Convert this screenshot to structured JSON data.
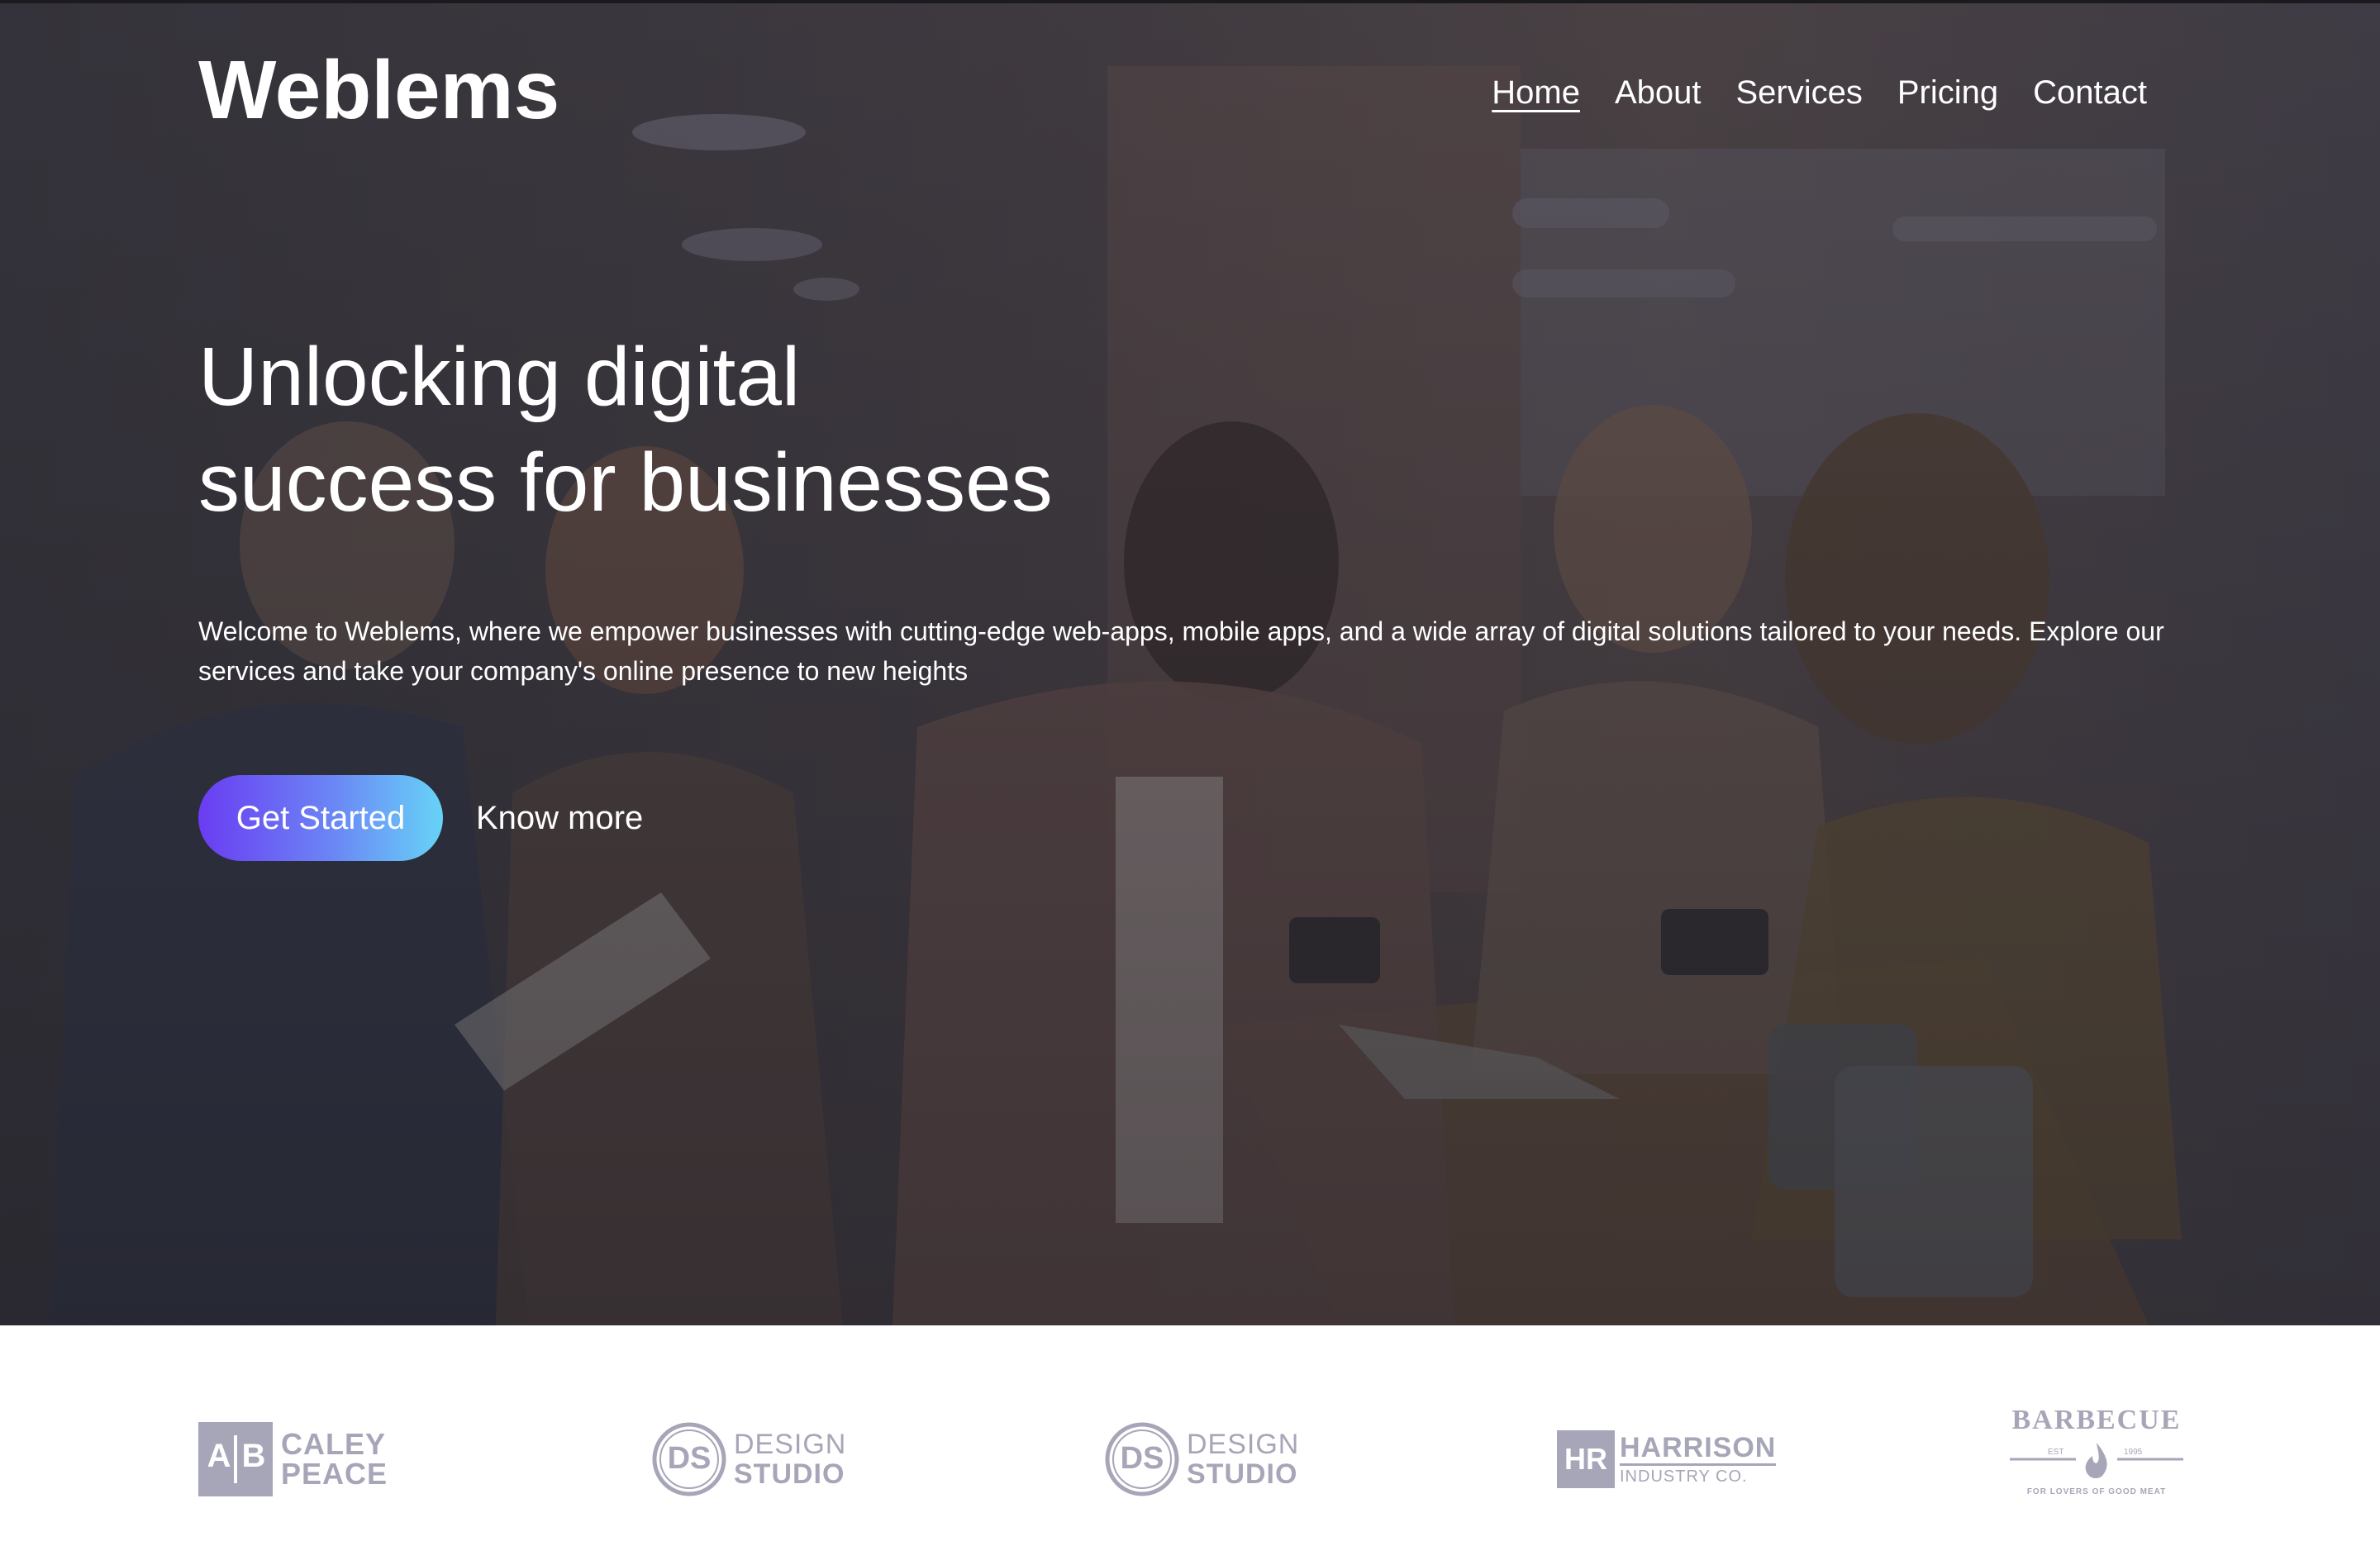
{
  "brand": {
    "name": "Weblems"
  },
  "nav": {
    "items": [
      {
        "label": "Home",
        "active": true
      },
      {
        "label": "About"
      },
      {
        "label": "Services"
      },
      {
        "label": "Pricing"
      },
      {
        "label": "Contact"
      }
    ]
  },
  "hero": {
    "headline_line1": "Unlocking digital",
    "headline_line2": "success for businesses",
    "intro": "Welcome to Weblems, where we empower businesses with cutting-edge web-apps, mobile apps, and a wide array of digital solutions tailored to your needs. Explore our services and take your company's online presence to new heights",
    "primary_cta": "Get Started",
    "secondary_cta": "Know more"
  },
  "partners": {
    "caley_peace": {
      "mark_left": "A",
      "mark_right": "B",
      "line1": "CALEY",
      "line2": "PEACE"
    },
    "design_studio_1": {
      "mark": "DS",
      "line1": "DESIGN",
      "line2": "STUDIO"
    },
    "design_studio_2": {
      "mark": "DS",
      "line1": "DESIGN",
      "line2": "STUDIO"
    },
    "harrison": {
      "mark": "HR",
      "line1": "HARRISON",
      "line2": "INDUSTRY CO."
    },
    "barbecue": {
      "title": "BARBECUE",
      "est": "EST",
      "year": "1995",
      "tagline": "FOR LOVERS OF GOOD MEAT"
    }
  },
  "colors": {
    "overlay": "#3f3b42",
    "button_gradient_start": "#6a3cf2",
    "button_gradient_end": "#67d3f7",
    "partner_logo": "#a6a6b8"
  }
}
